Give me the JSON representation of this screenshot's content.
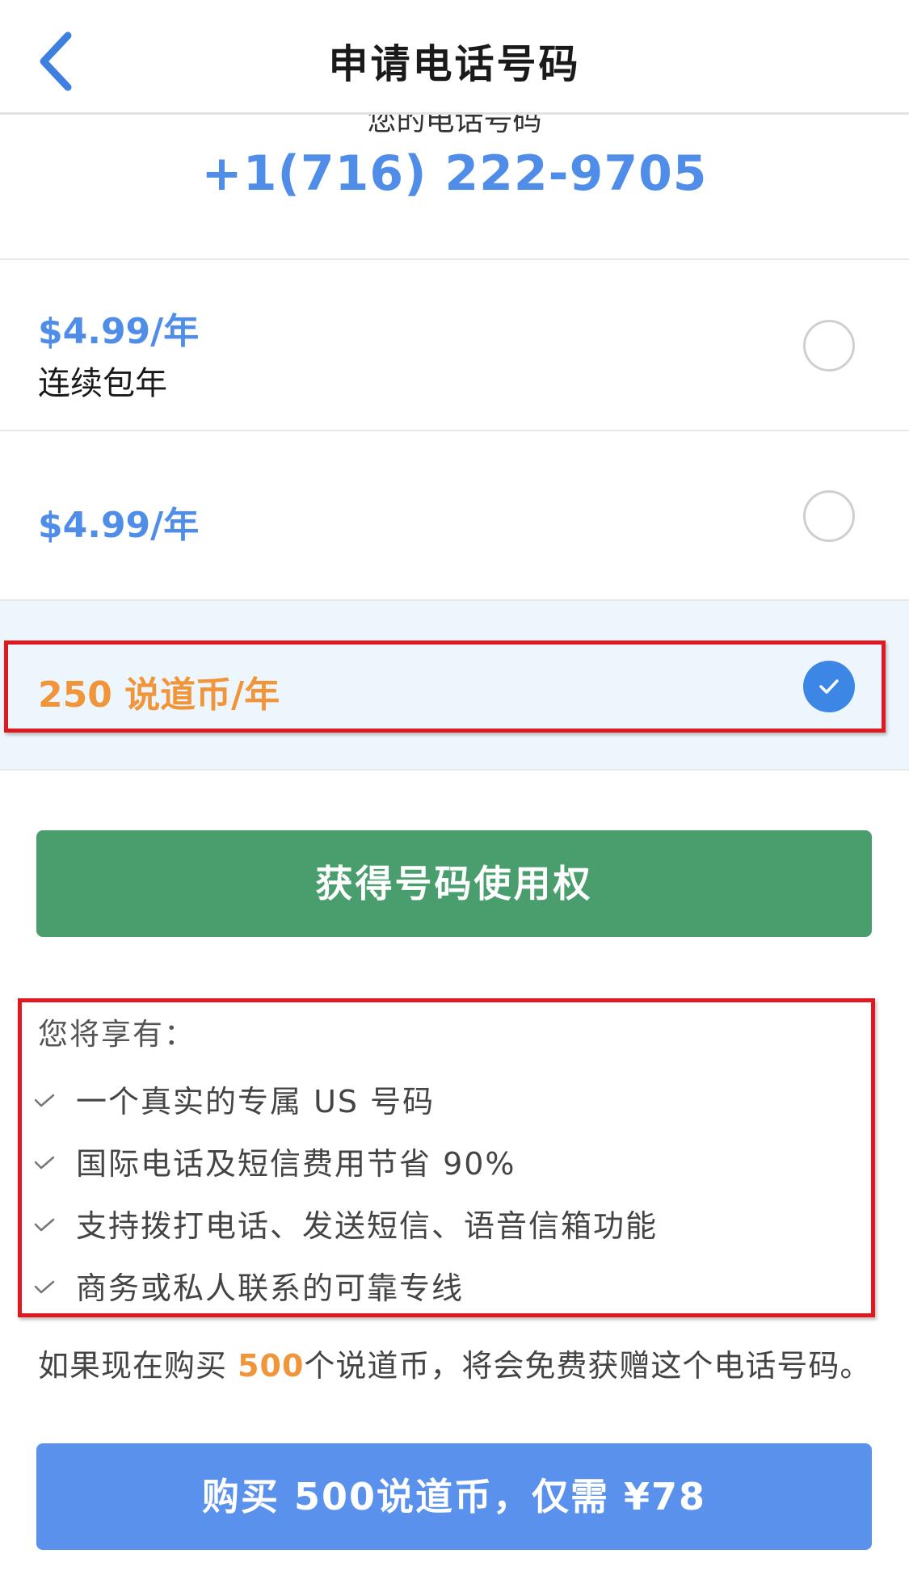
{
  "header": {
    "title": "申请电话号码"
  },
  "phone": {
    "clipped_label": "您的电话号码",
    "number": "+1(716) 222-9705"
  },
  "options": [
    {
      "price": "$4.99/年",
      "subtitle": "连续包年",
      "selected": false
    },
    {
      "price": "$4.99/年",
      "subtitle": "",
      "selected": false
    },
    {
      "price": "250 说道币/年",
      "subtitle": "",
      "selected": true
    }
  ],
  "get_number_button": "获得号码使用权",
  "benefits": {
    "title": "您将享有：",
    "items": [
      "一个真实的专属 US 号码",
      "国际电话及短信费用节省 90%",
      "支持拨打电话、发送短信、语音信箱功能",
      "商务或私人联系的可靠专线"
    ]
  },
  "promo": {
    "prefix": "如果现在购买 ",
    "highlight": "500",
    "suffix": "个说道币，将会免费获赠这个电话号码。"
  },
  "buy_button": "购买 500说道币，仅需 ¥78",
  "colors": {
    "accent_blue": "#4f8de8",
    "accent_orange": "#f0953a",
    "green_button": "#4a9e6e",
    "blue_button": "#5a91ec",
    "annotation_red": "#e01820"
  }
}
